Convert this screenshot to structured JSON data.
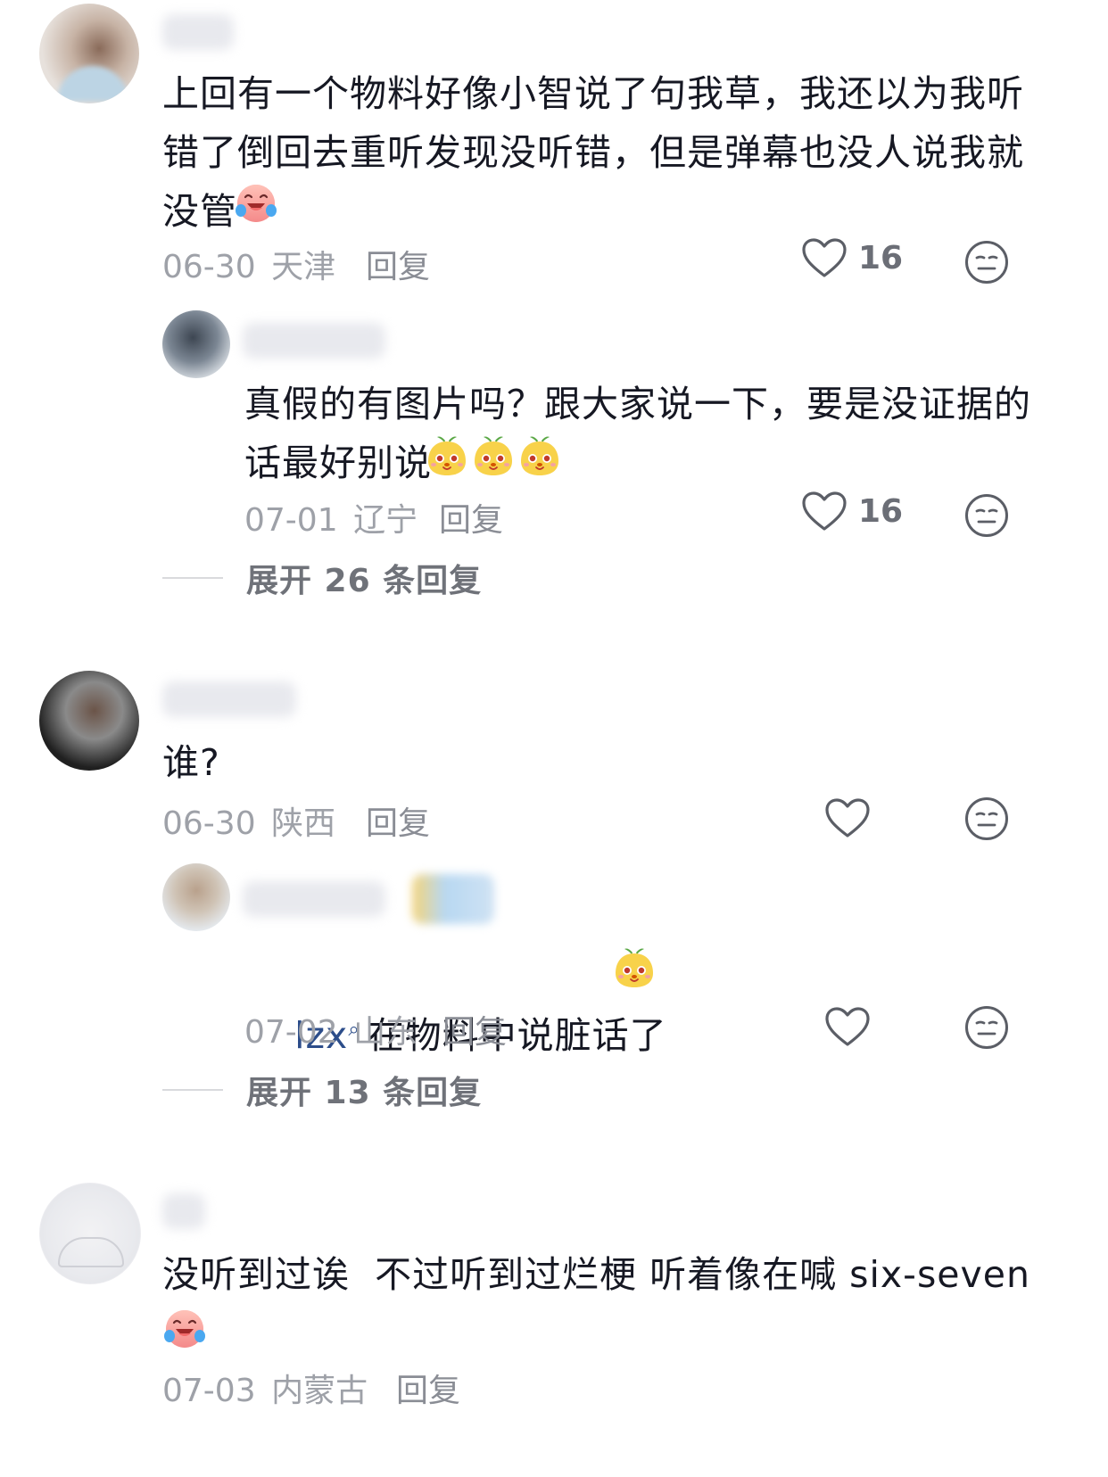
{
  "comments": [
    {
      "text": "上回有一个物料好像小智说了句我草，我还以为我听\n错了倒回去重听发现没听错，但是弹幕也没人说我就\n没管",
      "date": "06-30",
      "location": "天津",
      "reply_label": "回复",
      "like_count": "16",
      "reply": {
        "text": "真假的有图片吗？跟大家说一下，要是没证据的\n话最好别说",
        "date": "07-01",
        "location": "辽宁",
        "reply_label": "回复",
        "like_count": "16"
      },
      "expand_label": "展开 26 条回复"
    },
    {
      "text": "谁?",
      "date": "06-30",
      "location": "陕西",
      "reply_label": "回复",
      "like_count": "",
      "reply": {
        "mention": "lzx",
        "text": "在物料中说脏话了",
        "date": "07-02",
        "location": "山东",
        "reply_label": "回复",
        "like_count": ""
      },
      "expand_label": "展开 13 条回复"
    },
    {
      "text": "没听到过诶  不过听到过烂梗 听着像在喊 six-seven",
      "date": "07-03",
      "location": "内蒙古",
      "reply_label": "回复"
    }
  ],
  "icons": {
    "like": "heart-outline-icon",
    "dislike": "meh-face-icon",
    "emoji_cry": "laugh-cry-emoji",
    "emoji_cute": "cute-sprout-emoji"
  },
  "colors": {
    "text": "#161823",
    "meta": "#9ea1a8",
    "mention": "#2c4d8a"
  }
}
